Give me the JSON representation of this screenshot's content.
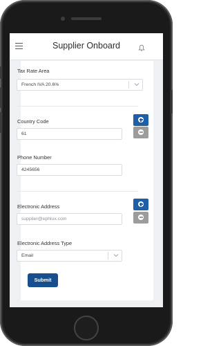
{
  "header": {
    "title": "Supplier Onboard",
    "menu_icon": "hamburger-icon",
    "notification_icon": "bell-icon"
  },
  "form": {
    "tax_rate_area": {
      "label": "Tax Rate Area",
      "value": "French IVA 20.6%"
    },
    "country_code": {
      "label": "Country Code",
      "value": "61"
    },
    "phone_number": {
      "label": "Phone Number",
      "value": "4245656"
    },
    "electronic_address": {
      "label": "Electronic Address",
      "placeholder": "supplier@ephlux.com"
    },
    "electronic_address_type": {
      "label": "Electronic Address Type",
      "value": "Email"
    },
    "submit_label": "Submit"
  },
  "colors": {
    "primary": "#1f5fa8",
    "secondary_button": "#9c9c9c",
    "submit": "#174f8e"
  }
}
